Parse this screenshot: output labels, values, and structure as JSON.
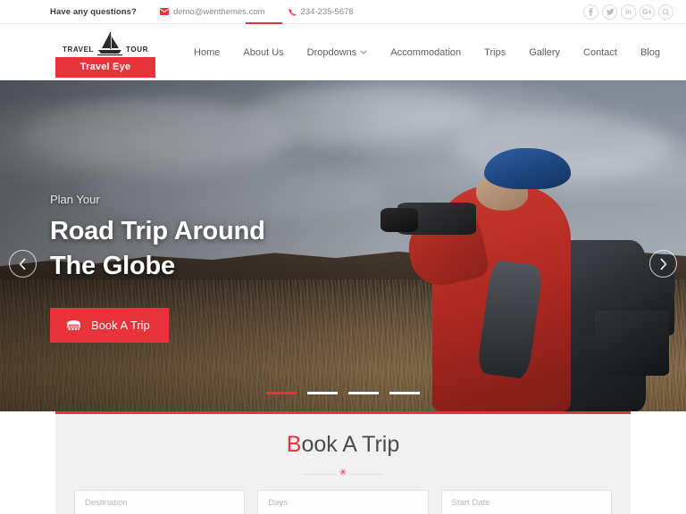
{
  "topbar": {
    "question": "Have any questions?",
    "email": "demo@wenthemes.com",
    "phone": "234-235-5678",
    "social": [
      {
        "name": "facebook-icon",
        "label": "f"
      },
      {
        "name": "twitter-icon",
        "label": "t"
      },
      {
        "name": "linkedin-icon",
        "label": "in"
      },
      {
        "name": "googleplus-icon",
        "label": "G+"
      },
      {
        "name": "search-icon",
        "label": "search"
      }
    ]
  },
  "logo": {
    "left_word": "TRAVEL",
    "right_word": "TOUR",
    "banner": "Travel Eye",
    "mark": "sailboat-icon"
  },
  "nav": {
    "items": [
      {
        "label": "Home",
        "dropdown": false
      },
      {
        "label": "About Us",
        "dropdown": false
      },
      {
        "label": "Dropdowns",
        "dropdown": true
      },
      {
        "label": "Accommodation",
        "dropdown": false
      },
      {
        "label": "Trips",
        "dropdown": false
      },
      {
        "label": "Gallery",
        "dropdown": false
      },
      {
        "label": "Contact",
        "dropdown": false
      },
      {
        "label": "Blog",
        "dropdown": false
      }
    ]
  },
  "hero": {
    "eyebrow": "Plan Your",
    "headline_line1": "Road Trip Around",
    "headline_line2": "The Globe",
    "cta_label": "Book A Trip",
    "cta_icon": "bus-icon",
    "prev_icon": "chevron-left-icon",
    "next_icon": "chevron-right-icon",
    "slides": [
      {
        "active": true
      },
      {
        "active": false
      },
      {
        "active": false
      },
      {
        "active": false
      }
    ]
  },
  "booking": {
    "title_first": "B",
    "title_rest": "ook A Trip",
    "divider_glyph": "✳",
    "fields": [
      {
        "name": "destination-input",
        "placeholder": "Destination"
      },
      {
        "name": "days-input",
        "placeholder": "Days"
      },
      {
        "name": "start-date-input",
        "placeholder": "Start Date"
      }
    ]
  },
  "colors": {
    "accent": "#e8333a",
    "panel_bg": "#f1f1f1",
    "nav_text": "#5f5f5f",
    "heading": "#4c4c4c"
  }
}
